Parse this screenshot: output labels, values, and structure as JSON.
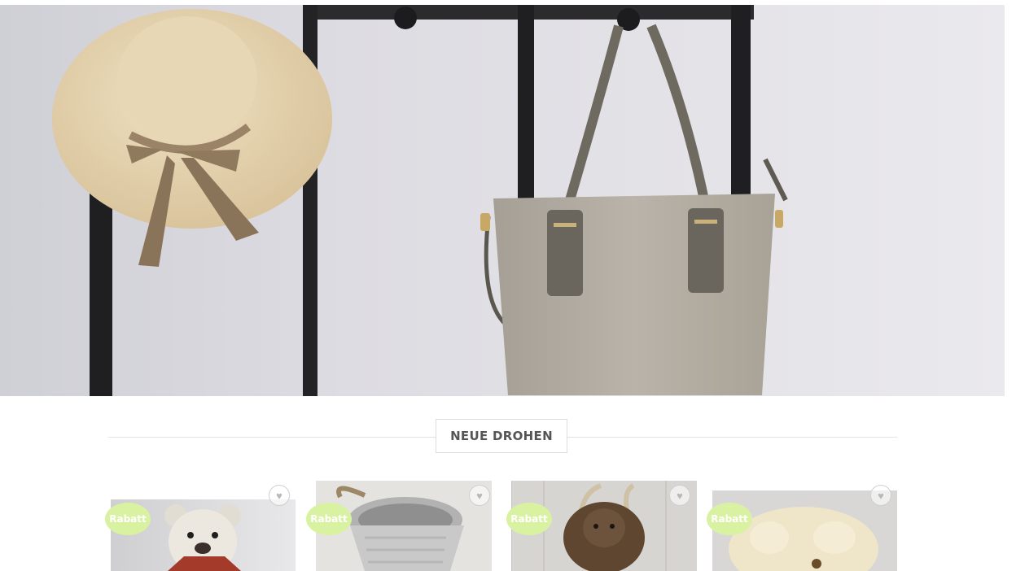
{
  "section": {
    "title": "NEUE DROHEN"
  },
  "products": [
    {
      "badge": "Rabatt",
      "image": "white-teddy-bear-with-scarf",
      "wishlist_icon": "heart-icon"
    },
    {
      "badge": "Rabatt",
      "image": "grey-knitted-basket",
      "wishlist_icon": "heart-icon"
    },
    {
      "badge": "Rabatt",
      "image": "brown-plush-highland-cow",
      "wishlist_icon": "heart-icon"
    },
    {
      "badge": "Rabatt",
      "image": "cream-fluffy-teddy-bear",
      "wishlist_icon": "heart-icon"
    }
  ],
  "colors": {
    "badge": "#d9f2a2",
    "title_text": "#555555",
    "rule": "#e3e3e3"
  }
}
